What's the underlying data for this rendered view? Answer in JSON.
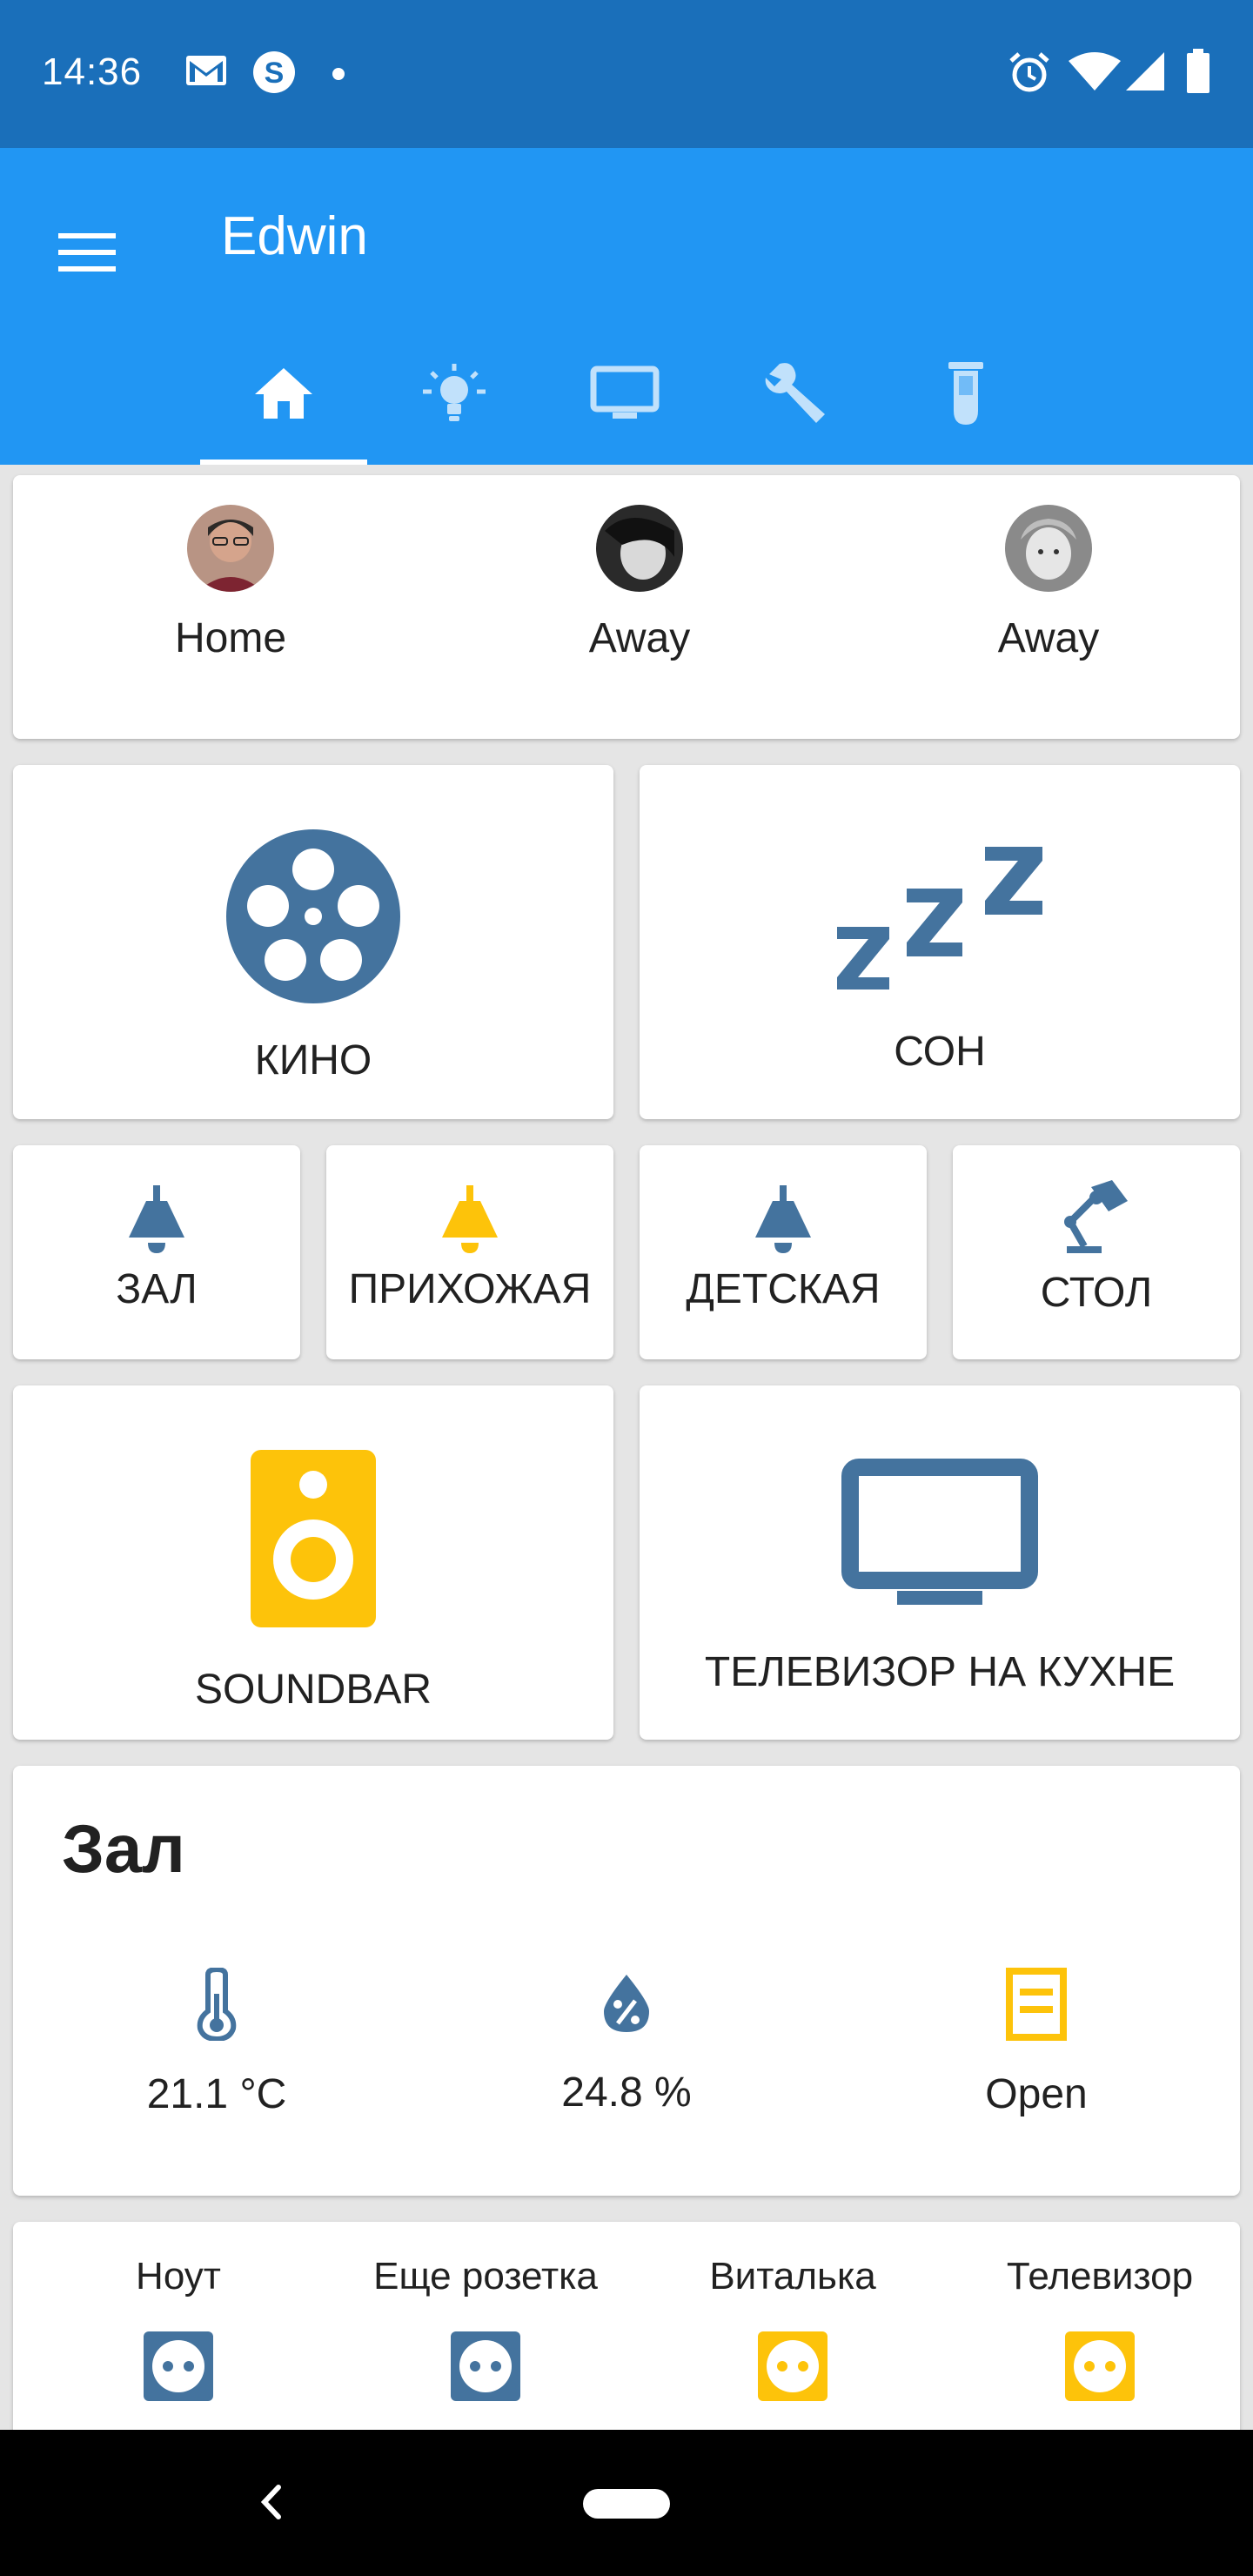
{
  "status_bar": {
    "time": "14:36"
  },
  "app_bar": {
    "title": "Edwin"
  },
  "tabs": [
    {
      "icon": "home-icon",
      "active": true
    },
    {
      "icon": "lightbulb-icon",
      "active": false
    },
    {
      "icon": "monitor-icon",
      "active": false
    },
    {
      "icon": "wrench-icon",
      "active": false
    },
    {
      "icon": "test-tube-icon",
      "active": false
    }
  ],
  "people": [
    {
      "state": "Home"
    },
    {
      "state": "Away"
    },
    {
      "state": "Away"
    }
  ],
  "scenes": [
    {
      "label": "КИНО",
      "icon": "film-reel-icon"
    },
    {
      "label": "СОН",
      "icon": "sleep-zzz-icon"
    }
  ],
  "lights": [
    {
      "label": "ЗАЛ",
      "icon": "ceiling-light-icon",
      "on": false
    },
    {
      "label": "ПРИХОЖАЯ",
      "icon": "ceiling-light-icon",
      "on": true
    },
    {
      "label": "ДЕТСКАЯ",
      "icon": "ceiling-light-icon",
      "on": false
    },
    {
      "label": "СТОЛ",
      "icon": "desk-lamp-icon",
      "on": false
    }
  ],
  "media": [
    {
      "label": "SOUNDBAR",
      "icon": "speaker-icon",
      "on": true
    },
    {
      "label": "ТЕЛЕВИЗОР НА КУХНЕ",
      "icon": "tv-icon",
      "on": false
    }
  ],
  "room": {
    "title": "Зал",
    "sensors": [
      {
        "value": "21.1 °C",
        "icon": "thermometer-icon"
      },
      {
        "value": "24.8 %",
        "icon": "water-percent-icon"
      },
      {
        "value": "Open",
        "icon": "window-open-icon"
      }
    ]
  },
  "outlets": [
    {
      "label": "Ноут",
      "on": false
    },
    {
      "label": "Еще розетка",
      "on": false
    },
    {
      "label": "Виталька",
      "on": true
    },
    {
      "label": "Телевизор",
      "on": true
    }
  ],
  "colors": {
    "status_bar": "#1a6fba",
    "app_bar": "#2196f3",
    "icon_off": "#44739e",
    "icon_on": "#fdc30a",
    "card": "#ffffff"
  }
}
